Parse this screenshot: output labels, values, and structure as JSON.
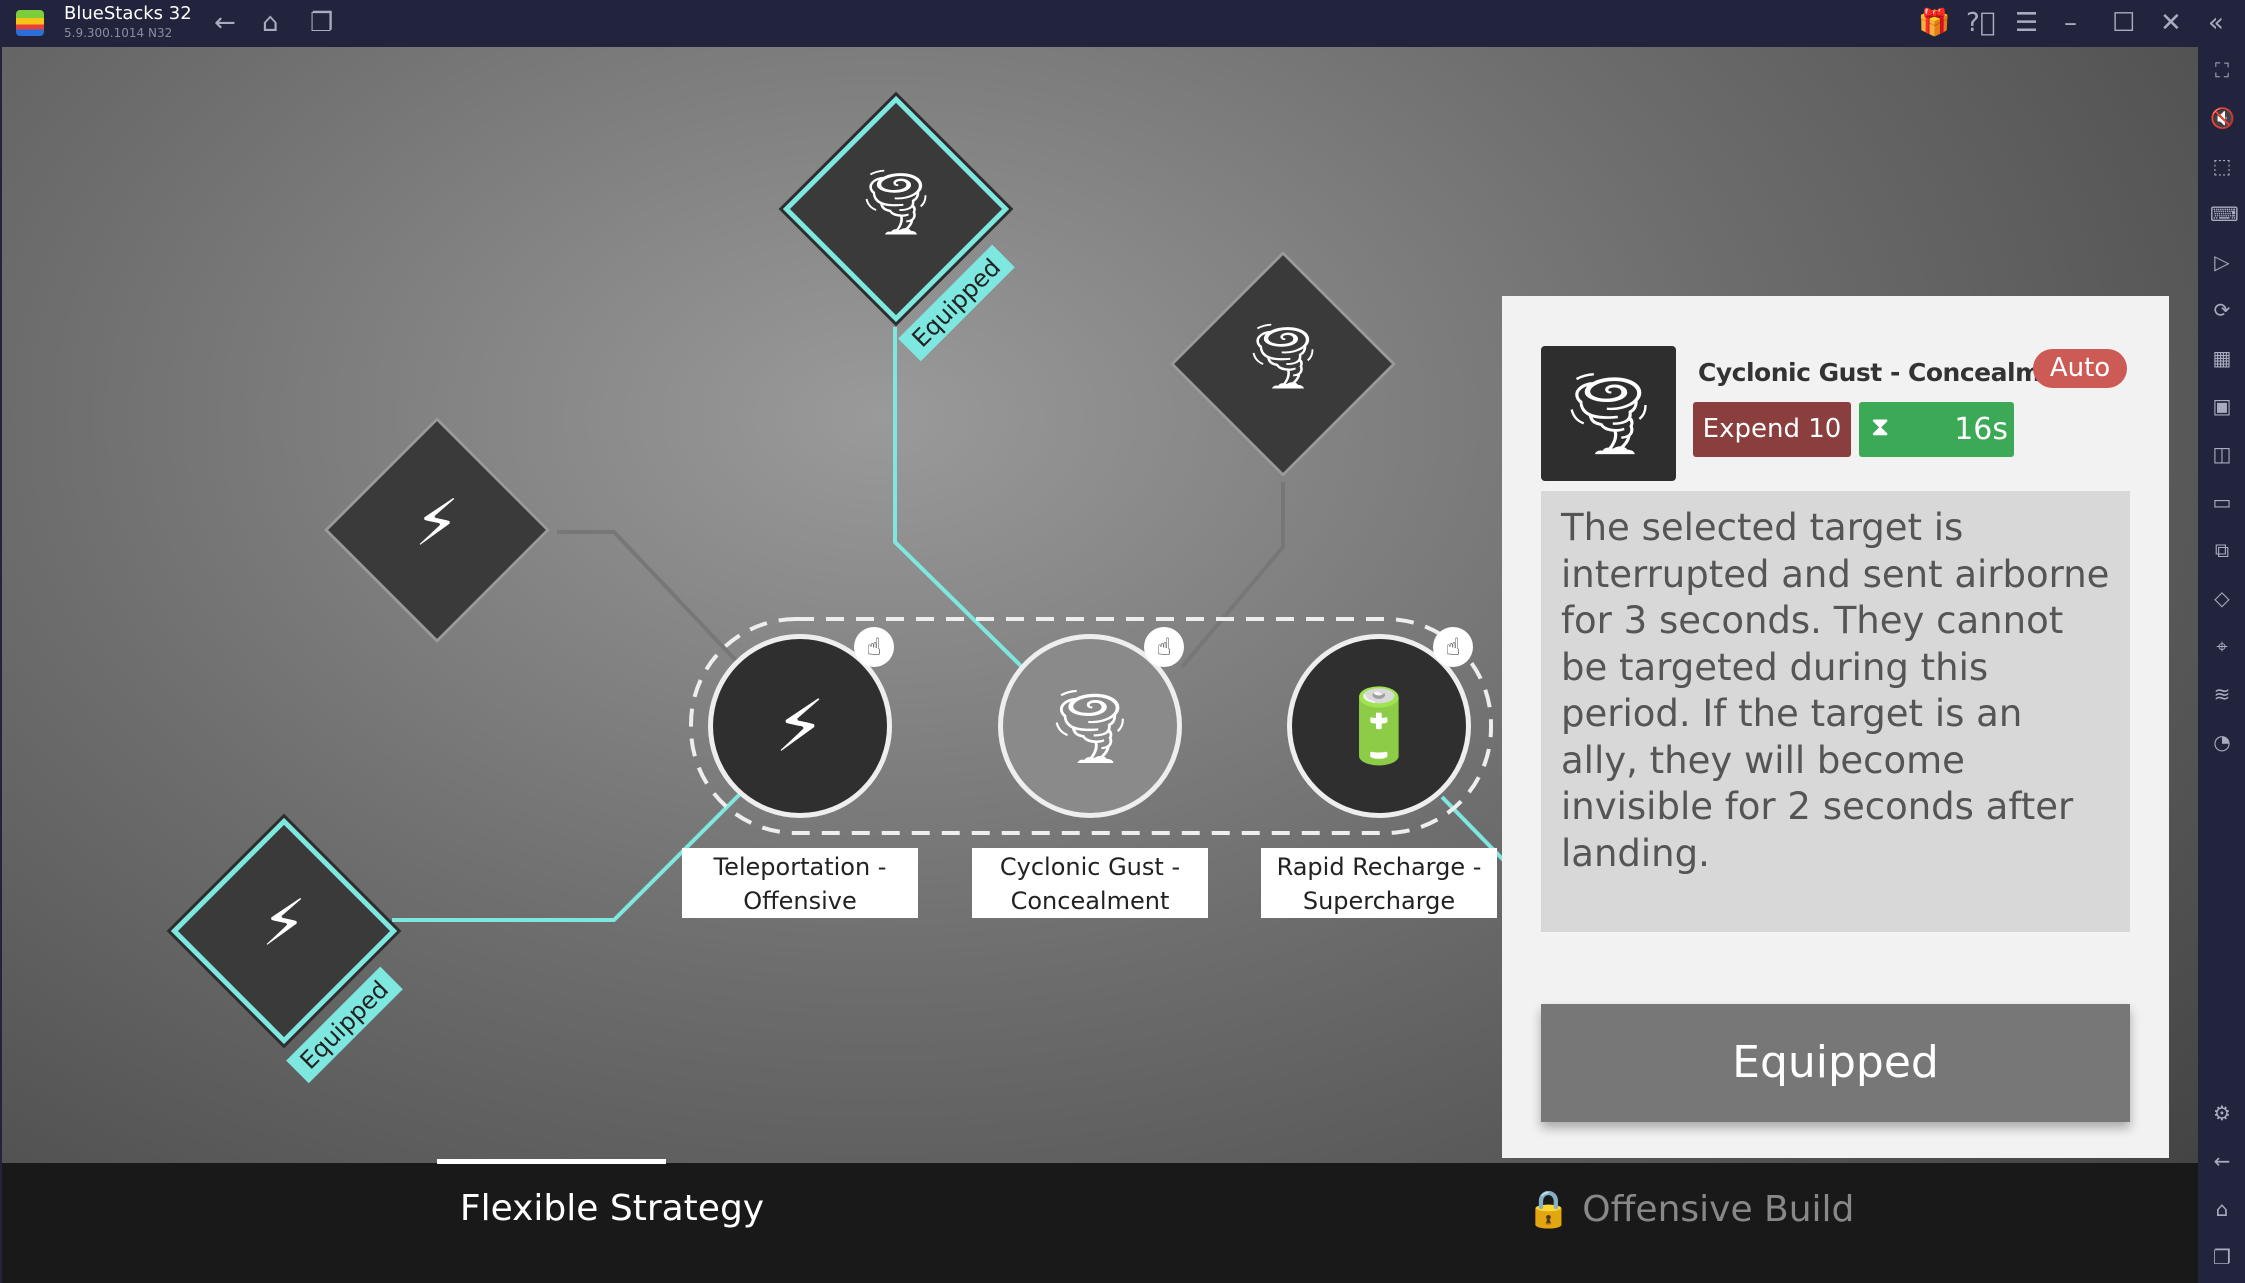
{
  "titlebar": {
    "app_name": "BlueStacks 32",
    "version": "5.9.300.1014  N32",
    "icons": [
      "back-icon",
      "home-icon",
      "multi-instance-icon",
      "gift-icon",
      "help-icon",
      "menu-icon",
      "minimize-icon",
      "maximize-icon",
      "close-icon",
      "collapse-sidebar-icon"
    ]
  },
  "sidebar": {
    "icons": [
      "fullscreen-icon",
      "volume-icon",
      "pointer-icon",
      "keyboard-icon",
      "record-icon",
      "rotate-icon",
      "macro-icon",
      "apk-icon",
      "screenshot-icon",
      "folder-icon",
      "resize-icon",
      "eco-icon",
      "location-icon",
      "layers-icon",
      "performance-icon",
      "settings-icon",
      "back-icon",
      "home-icon",
      "recents-icon"
    ]
  },
  "skill_tree": {
    "equipped_tag": "Equipped",
    "options": [
      {
        "label_line1": "Teleportation -",
        "label_line2": "Offensive"
      },
      {
        "label_line1": "Cyclonic Gust -",
        "label_line2": "Concealment"
      },
      {
        "label_line1": "Rapid Recharge -",
        "label_line2": "Supercharge"
      }
    ]
  },
  "panel": {
    "title": "Cyclonic Gust - Concealment",
    "badge": "Auto",
    "cost": "Expend 10",
    "cooldown": "16s",
    "description": "The selected target is interrupted and sent airborne for 3 seconds. They cannot be targeted during this period. If the target is an ally, they will become invisible for 2 seconds after landing.",
    "button": "Equipped",
    "colors": {
      "badge": "#cc5a55",
      "cost": "#8a3e3e",
      "cooldown": "#3ca957"
    }
  },
  "tabs": [
    {
      "label": "Flexible Strategy",
      "active": true
    },
    {
      "label": "Offensive Build",
      "locked": true
    }
  ]
}
